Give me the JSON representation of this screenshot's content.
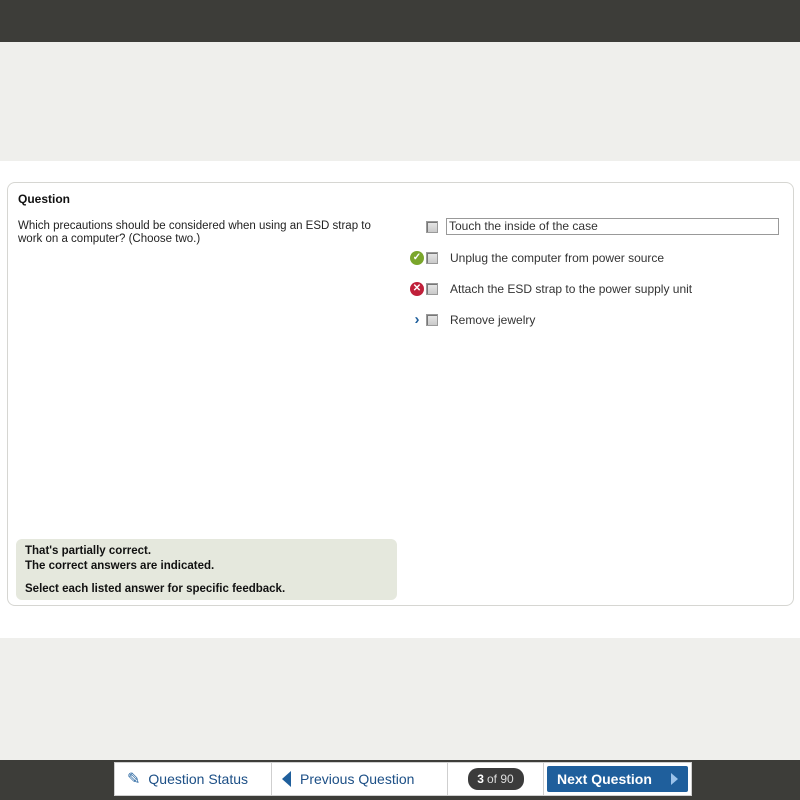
{
  "question": {
    "heading": "Question",
    "text": "Which precautions should be considered when using an ESD strap to work on a computer? (Choose two.)"
  },
  "answers": [
    {
      "label": "Touch the inside of the case",
      "indicator": "none"
    },
    {
      "label": "Unplug the computer from power source",
      "indicator": "correct-check-icon"
    },
    {
      "label": "Attach the ESD strap to the power supply unit",
      "indicator": "incorrect-x-icon"
    },
    {
      "label": "Remove jewelry",
      "indicator": "missed-chevron-icon"
    }
  ],
  "feedback": {
    "line1": "That's partially correct.",
    "line2": "The correct answers are indicated.",
    "line3": "Select each listed answer for specific feedback."
  },
  "nav": {
    "status_label": "Question Status",
    "prev_label": "Previous Question",
    "current_page": "3",
    "of_label": "of 90",
    "next_label": "Next Question"
  },
  "colors": {
    "accent": "#1f5f9c",
    "correct": "#7aa62b",
    "incorrect": "#c0203a",
    "frame": "#3d3d39",
    "feedback_bg": "#e5e8dd"
  }
}
